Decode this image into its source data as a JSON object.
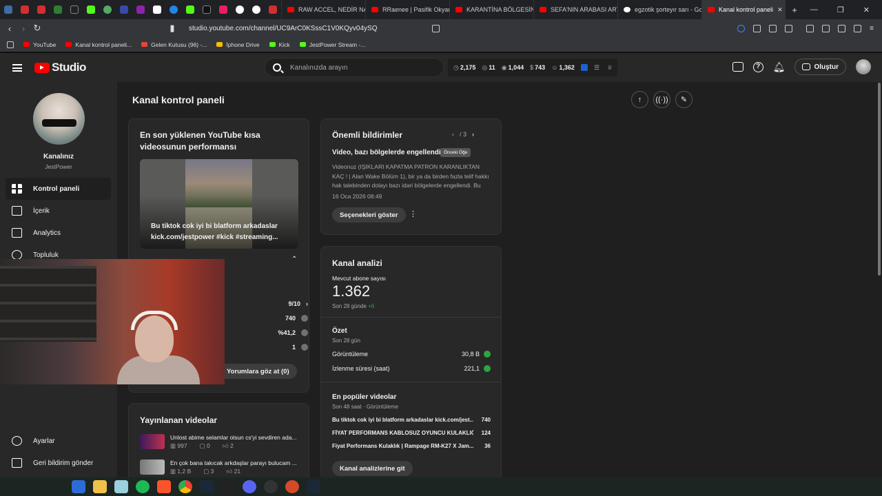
{
  "browser": {
    "tabs": [
      {
        "label": "RAW ACCEL, NEDİR NASIL"
      },
      {
        "label": "RRaenee | Pasifik Okyanusu"
      },
      {
        "label": "KARANTİNA BÖLGESİNİN"
      },
      {
        "label": "SEFA'NIN ARABASI ARTIK"
      },
      {
        "label": "egzotik şorteyır sarı - Google"
      },
      {
        "label": "Kanal kontrol paneli"
      }
    ],
    "url": "studio.youtube.com/channel/UC9ArC0KSssC1V0KQyv04ySQ",
    "bookmarks": [
      "YouTube",
      "Kanal kontrol paneli...",
      "Gelen Kutusu (96) -...",
      "İphone Drive",
      "Kick",
      "JestPower Stream -..."
    ]
  },
  "studio": {
    "logo_text": "Studio",
    "search_placeholder": "Kanalınızda arayın",
    "stats": [
      "2,175",
      "11",
      "1,044",
      "743",
      "1,362"
    ],
    "create_label": "Oluştur"
  },
  "sidebar": {
    "channel_title": "Kanalınız",
    "channel_name": "JestPower",
    "items": [
      {
        "label": "Kontrol paneli"
      },
      {
        "label": "İçerik"
      },
      {
        "label": "Analytics"
      },
      {
        "label": "Topluluk"
      }
    ],
    "settings": "Ayarlar",
    "feedback": "Geri bildirim gönder"
  },
  "main": {
    "page_title": "Kanal kontrol paneli",
    "shorts_card": {
      "title": "En son yüklenen YouTube kısa videosunun performansı",
      "thumb_title": "Bu tiktok cok iyi bi blatform arkadaslar kick.com/jestpower #kick #streaming...",
      "rows": [
        {
          "value": "9/10"
        },
        {
          "value": "740"
        },
        {
          "value": "%41,2"
        },
        {
          "value": "1"
        }
      ],
      "comments_button": "Yorumlara göz at (0)"
    },
    "notices": {
      "title": "Önemli bildirimler",
      "pager": "/ 3",
      "tooltip": "Önceki Öğe",
      "heading": "Video, bazı bölgelerde engellendi",
      "body": "Videonuz (IŞIKLARI KAPATMA PATRON KARANLIKTAN KAÇ ! | Alan Wake Bölüm 1), bir ya da birden fazla telif hakkı hak talebinden dolayı bazı idari bölgelerde engellendi. Bu bir...",
      "date": "16 Oca 2026 08:49",
      "options_button": "Seçenekleri göster"
    },
    "analytics": {
      "title": "Kanal analizi",
      "subs_label": "Mevcut abone sayısı",
      "subs_value": "1.362",
      "subs_period": "Son 28 günde",
      "subs_delta": "+6",
      "summary_title": "Özet",
      "summary_period": "Son 28 gün",
      "rows": [
        {
          "label": "Görüntüleme",
          "value": "30,8 B"
        },
        {
          "label": "İzlenme süresi (saat)",
          "value": "221,1"
        }
      ],
      "top_title": "En popüler videolar",
      "top_period": "Son 48 saat · Görüntüleme",
      "top_videos": [
        {
          "title": "Bu tiktok cok iyi bi blatform arkadaslar kick.com/jest...",
          "views": "740"
        },
        {
          "title": "FİYAT PERFORMANS KABLOSUZ OYUNCU KULAKLIĞ...",
          "views": "124"
        },
        {
          "title": "Fiyat Performans Kulaklık | Rampage RM-K27 X Jam...",
          "views": "36"
        }
      ],
      "go_button": "Kanal analizlerine git"
    },
    "published": {
      "title": "Yayınlanan videolar",
      "videos": [
        {
          "title": "Unlost abime selamlar olsun cs'yi sevdiren ada...",
          "views": "997",
          "comments": "0",
          "likes": "2"
        },
        {
          "title": "En çok bana takıcak arkdaşlar parayı bulucam ...",
          "views": "1,2 B",
          "comments": "3",
          "likes": "21"
        }
      ]
    }
  },
  "colors": {
    "accent": "#ff0000",
    "positive": "#2ba640",
    "bg": "#1f1f1f",
    "card": "#282828"
  }
}
